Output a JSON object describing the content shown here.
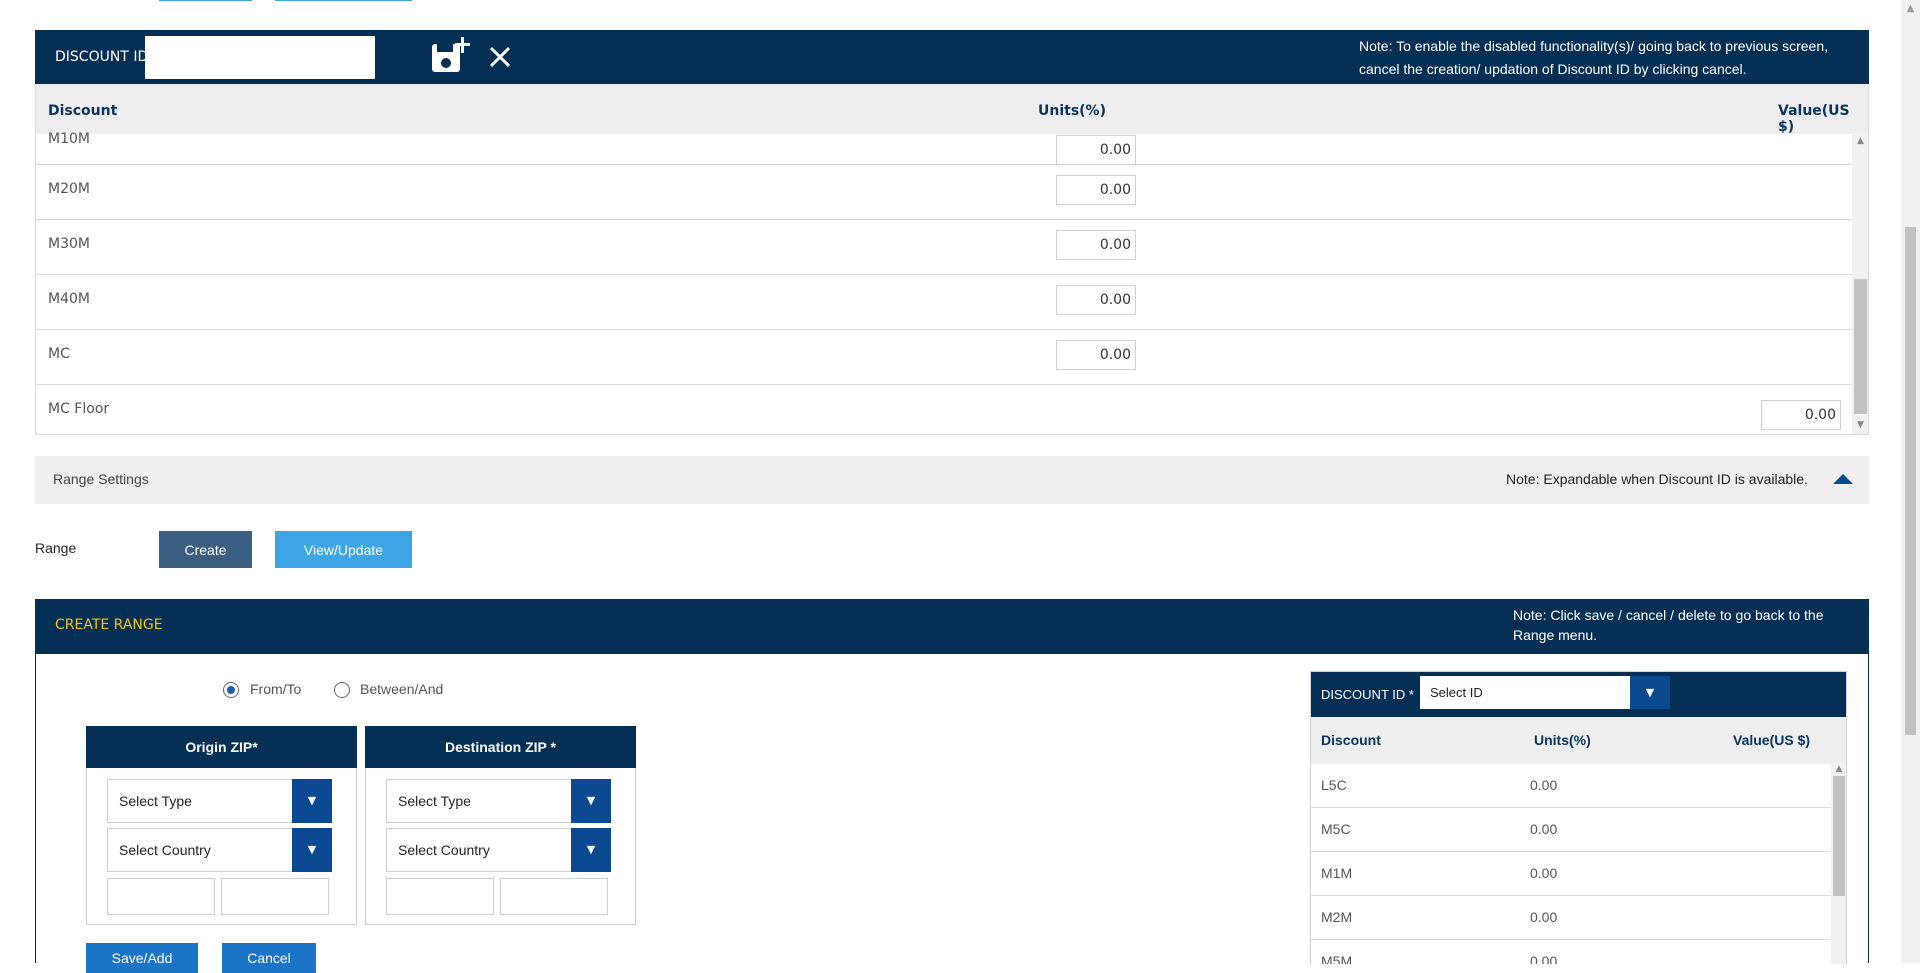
{
  "discount_header": {
    "label": "DISCOUNT ID",
    "id_value": "",
    "note": "Note: To enable the disabled functionality(s)/ going back to previous screen, cancel the creation/ updation of Discount ID by clicking cancel."
  },
  "discount_table": {
    "columns": [
      "Discount",
      "Units(%)",
      "Value(US $)"
    ],
    "rows": [
      {
        "name": "M10M",
        "units": "0.00",
        "value": ""
      },
      {
        "name": "M20M",
        "units": "0.00",
        "value": ""
      },
      {
        "name": "M30M",
        "units": "0.00",
        "value": ""
      },
      {
        "name": "M40M",
        "units": "0.00",
        "value": ""
      },
      {
        "name": "MC",
        "units": "0.00",
        "value": ""
      },
      {
        "name": "MC Floor",
        "units": "",
        "value": "0.00"
      }
    ]
  },
  "range_settings": {
    "title": "Range Settings",
    "note": "Note: Expandable when Discount ID is available."
  },
  "range": {
    "label": "Range",
    "create_label": "Create",
    "view_update_label": "View/Update"
  },
  "create_range": {
    "title": "CREATE RANGE",
    "note": "Note: Click save / cancel / delete to go back to the Range menu.",
    "radio_from_to": "From/To",
    "radio_between_and": "Between/And",
    "origin": {
      "title": "Origin ZIP*",
      "type_placeholder": "Select Type",
      "country_placeholder": "Select Country"
    },
    "destination": {
      "title": "Destination ZIP *",
      "type_placeholder": "Select Type",
      "country_placeholder": "Select Country"
    },
    "save_label": "Save/Add",
    "cancel_label": "Cancel"
  },
  "right_panel": {
    "label": "DISCOUNT ID *",
    "select_value": "Select ID",
    "columns": [
      "Discount",
      "Units(%)",
      "Value(US $)"
    ],
    "rows": [
      {
        "name": "L5C",
        "units": "0.00"
      },
      {
        "name": "M5C",
        "units": "0.00"
      },
      {
        "name": "M1M",
        "units": "0.00"
      },
      {
        "name": "M2M",
        "units": "0.00"
      },
      {
        "name": "M5M",
        "units": "0.00"
      }
    ]
  },
  "colors": {
    "navy": "#062f55",
    "accent_blue": "#3da4e6",
    "dropdown_blue": "#0b4a91",
    "create_title_yellow": "#f2c21b"
  }
}
